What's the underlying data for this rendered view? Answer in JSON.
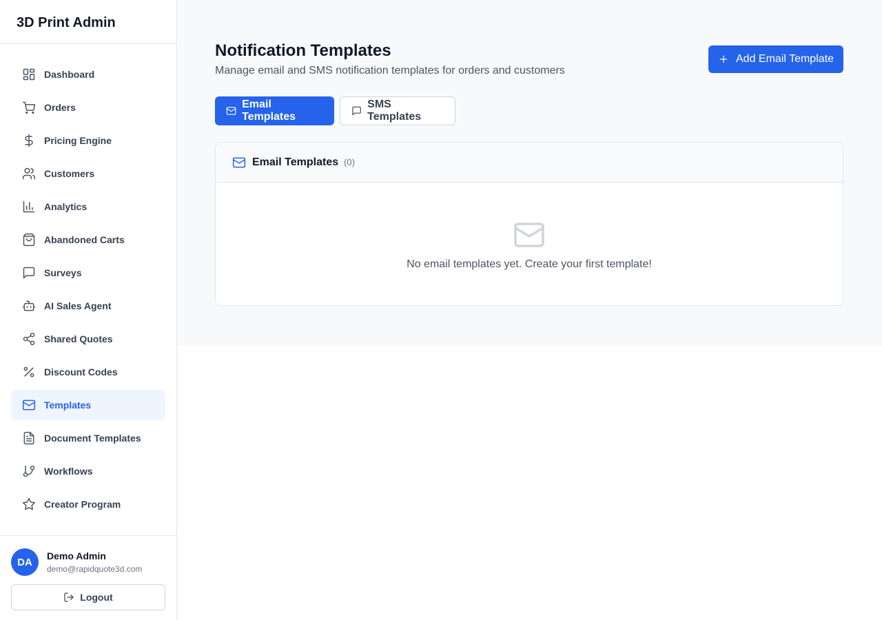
{
  "app": {
    "title": "3D Print Admin"
  },
  "sidebar": {
    "items": [
      {
        "label": "Dashboard",
        "icon": "dashboard-icon"
      },
      {
        "label": "Orders",
        "icon": "cart-icon"
      },
      {
        "label": "Pricing Engine",
        "icon": "dollar-icon"
      },
      {
        "label": "Customers",
        "icon": "users-icon"
      },
      {
        "label": "Analytics",
        "icon": "bar-chart-icon"
      },
      {
        "label": "Abandoned Carts",
        "icon": "shopping-bag-icon"
      },
      {
        "label": "Surveys",
        "icon": "message-square-icon"
      },
      {
        "label": "AI Sales Agent",
        "icon": "bot-icon"
      },
      {
        "label": "Shared Quotes",
        "icon": "share-icon"
      },
      {
        "label": "Discount Codes",
        "icon": "percent-icon"
      },
      {
        "label": "Templates",
        "icon": "mail-icon",
        "active": true
      },
      {
        "label": "Document Templates",
        "icon": "file-text-icon"
      },
      {
        "label": "Workflows",
        "icon": "git-branch-icon"
      },
      {
        "label": "Creator Program",
        "icon": "star-icon"
      }
    ]
  },
  "user": {
    "initials": "DA",
    "name": "Demo Admin",
    "email": "demo@rapidquote3d.com",
    "logout_label": "Logout"
  },
  "main": {
    "title": "Notification Templates",
    "subtitle": "Manage email and SMS notification templates for orders and customers",
    "add_button_label": "Add Email Template",
    "tabs": [
      {
        "label": "Email Templates",
        "active": true
      },
      {
        "label": "SMS Templates",
        "active": false
      }
    ],
    "card": {
      "title": "Email Templates",
      "count": "(0)",
      "empty_text": "No email templates yet. Create your first template!"
    }
  },
  "colors": {
    "accent": "#2563eb",
    "active_bg": "#eef5ff",
    "main_bg": "#f8f9fb"
  }
}
